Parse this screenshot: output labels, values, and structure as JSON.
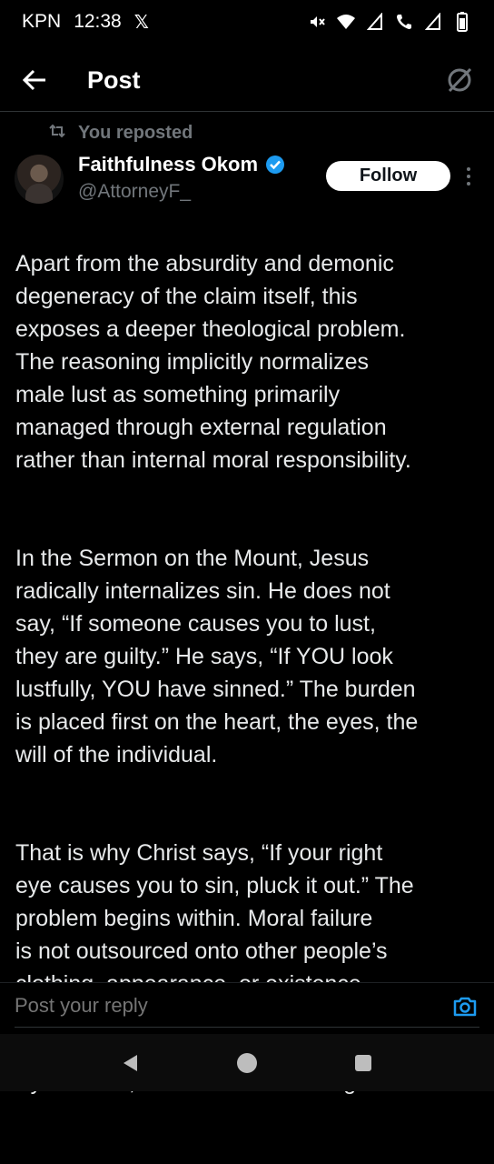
{
  "status_bar": {
    "carrier": "KPN",
    "time": "12:38",
    "app_icon": "x-logo-icon",
    "icons": [
      "mute-icon",
      "wifi-icon",
      "signal-icon",
      "wifi-calling-icon",
      "signal-icon",
      "battery-icon"
    ]
  },
  "header": {
    "title": "Post",
    "back_icon": "back-arrow-icon",
    "grok_icon": "grok-icon"
  },
  "post": {
    "repost_label": "You reposted",
    "author_name": "Faithfulness Okom",
    "author_handle": "@AttorneyF_",
    "verified": true,
    "follow_label": "Follow",
    "paragraphs": [
      "Apart from the absurdity and demonic\ndegeneracy of the claim itself, this\nexposes a deeper theological problem.\nThe reasoning implicitly normalizes\nmale lust as something primarily\nmanaged through external regulation\nrather than internal moral responsibility.",
      "In the Sermon on the Mount, Jesus\nradically internalizes sin. He does not\nsay, “If someone causes you to lust,\nthey are guilty.” He says, “If YOU look\nlustfully, YOU have sinned.” The burden\nis placed first on the heart, the eyes, the\nwill of the individual.",
      "That is why Christ says, “If your right\neye causes you to sin, pluck it out.” The\nproblem begins within. Moral failure\nis not outsourced onto other people’s\nclothing, appearance, or existence.",
      "By contrast, this kind of reasoning"
    ]
  },
  "reply": {
    "placeholder": "Post your reply"
  },
  "colors": {
    "background": "#000000",
    "text": "#e7e9ea",
    "muted": "#71767b",
    "accent": "#1d9bf0",
    "follow_bg": "#ffffff"
  }
}
